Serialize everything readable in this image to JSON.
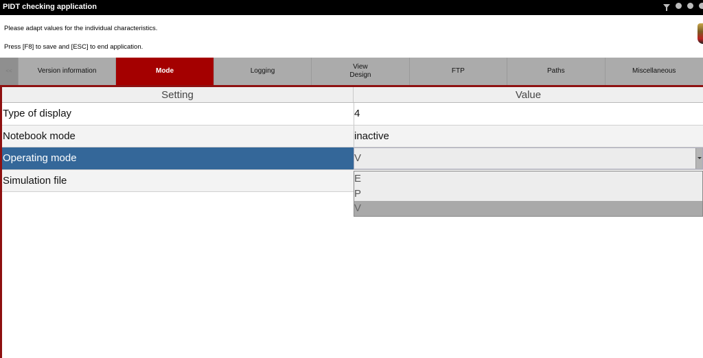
{
  "window": {
    "title": "PIDT checking application",
    "icons": [
      "filter-icon",
      "circle-icon",
      "circle-icon",
      "circle-icon"
    ]
  },
  "info": {
    "line1": "Please adapt values for the individual characteristics.",
    "line2": "Press [F8] to save and [ESC] to end application."
  },
  "tabs": {
    "scroll_label": "<<",
    "items": [
      {
        "label": "Version information",
        "active": false
      },
      {
        "label": "Mode",
        "active": true
      },
      {
        "label": "Logging",
        "active": false
      },
      {
        "label": "View\nDesign",
        "active": false
      },
      {
        "label": "FTP",
        "active": false
      },
      {
        "label": "Paths",
        "active": false
      },
      {
        "label": "Miscellaneous",
        "active": false
      }
    ]
  },
  "grid": {
    "headers": {
      "setting": "Setting",
      "value": "Value"
    },
    "rows": [
      {
        "setting": "Type of display",
        "value": "4"
      },
      {
        "setting": "Notebook mode",
        "value": "inactive"
      },
      {
        "setting": "Operating mode",
        "value": "V",
        "selected": true
      },
      {
        "setting": "Simulation file",
        "value": ""
      }
    ]
  },
  "dropdown": {
    "options": [
      "E",
      "P",
      "V"
    ],
    "selected": "V"
  },
  "colors": {
    "accent": "#a40000",
    "selection": "#346799"
  }
}
